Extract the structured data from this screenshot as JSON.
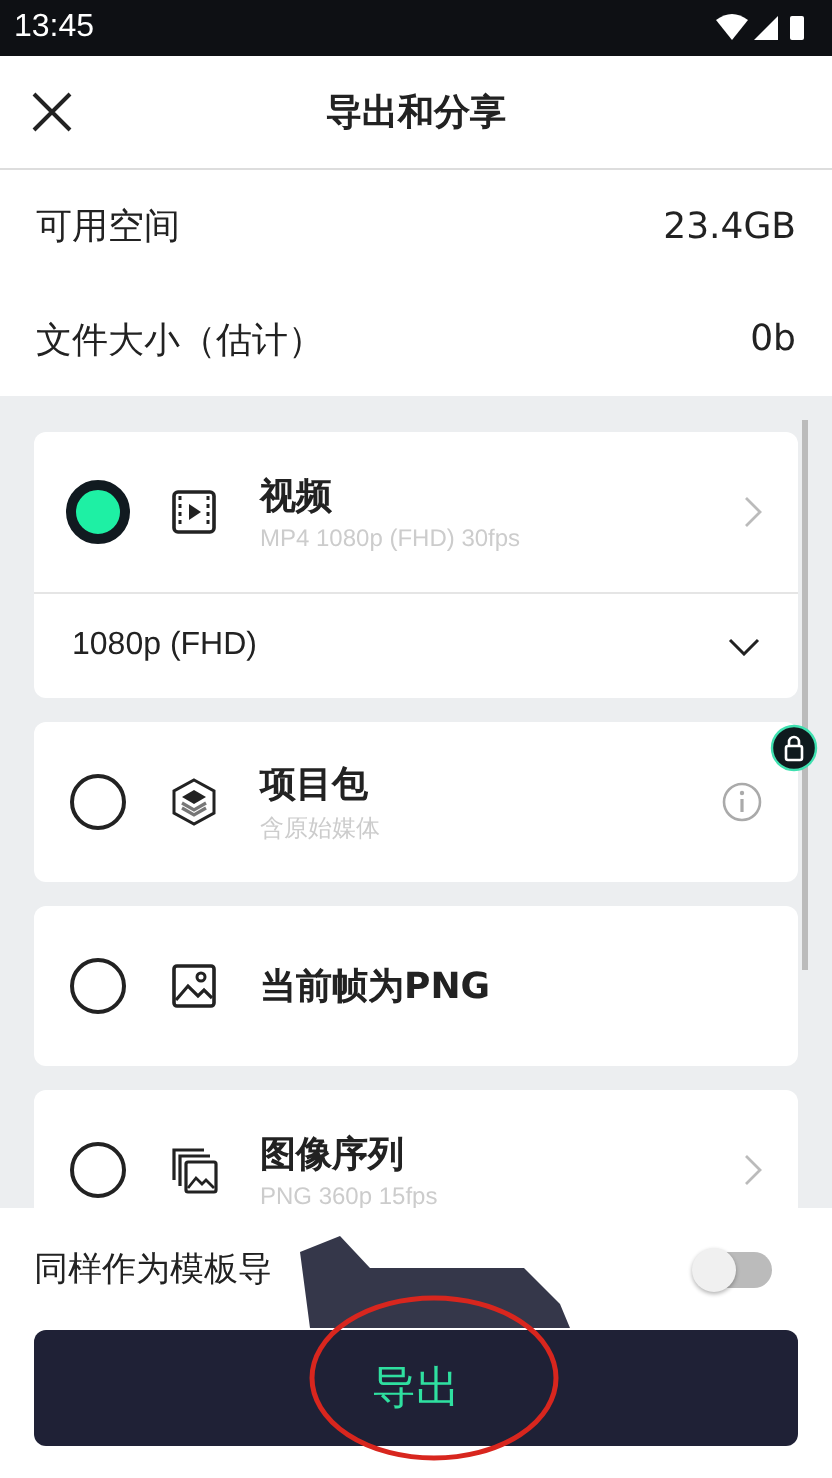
{
  "status_bar": {
    "time": "13:45"
  },
  "header": {
    "title": "导出和分享"
  },
  "info_rows": [
    {
      "label": "可用空间",
      "value": "23.4GB"
    },
    {
      "label": "文件大小（估计）",
      "value": "0b"
    }
  ],
  "options": [
    {
      "kind": "video",
      "title": "视频",
      "subtitle": "MP4 1080p (FHD) 30fps",
      "selected": true,
      "trailing": {
        "kind": "chevron"
      },
      "dropdown": "1080p (FHD)",
      "locked": false
    },
    {
      "kind": "package",
      "title": "项目包",
      "subtitle": "含原始媒体",
      "selected": false,
      "trailing": {
        "kind": "info"
      },
      "locked": true
    },
    {
      "kind": "image",
      "title": "当前帧为PNG",
      "selected": false,
      "locked": false
    },
    {
      "kind": "sequence",
      "title": "图像序列",
      "subtitle": "PNG 360p 15fps",
      "selected": false,
      "trailing": {
        "kind": "chevron"
      },
      "locked": false
    }
  ],
  "template_toggle": {
    "label": "同样作为模板导",
    "on": false
  },
  "export_button": {
    "label": "导出"
  }
}
